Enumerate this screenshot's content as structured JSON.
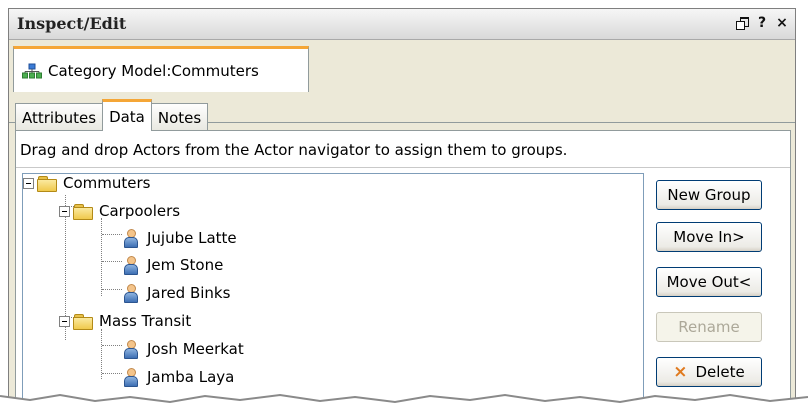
{
  "window": {
    "title": "Inspect/Edit",
    "controls": [
      {
        "name": "restore-icon",
        "glyph": ""
      },
      {
        "name": "help-icon",
        "glyph": "?"
      },
      {
        "name": "close-icon",
        "glyph": "×"
      }
    ]
  },
  "model_tab": {
    "label": "Category Model:Commuters",
    "icon": "hierarchy-icon",
    "accent": "#f5a636"
  },
  "sub_tabs": [
    {
      "label": "Attributes",
      "active": false
    },
    {
      "label": "Data",
      "active": true
    },
    {
      "label": "Notes",
      "active": false
    }
  ],
  "instruction": "Drag and drop Actors from the Actor navigator to assign them to groups.",
  "tree": {
    "root": "Commuters",
    "groups": [
      {
        "label": "Carpoolers",
        "members": [
          "Jujube Latte",
          "Jem Stone",
          "Jared Binks"
        ]
      },
      {
        "label": "Mass Transit",
        "members": [
          "Josh Meerkat",
          "Jamba Laya"
        ]
      }
    ]
  },
  "buttons": {
    "new_group": "New Group",
    "move_in": "Move In>",
    "move_out": "Move Out<",
    "rename": "Rename",
    "delete": "Delete",
    "delete_icon": "×",
    "rename_enabled": false
  }
}
